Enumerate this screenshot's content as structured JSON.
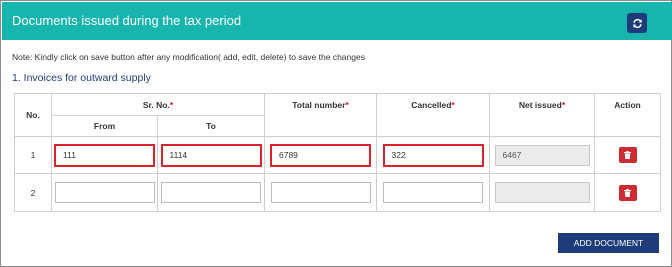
{
  "panel": {
    "title": "Documents issued during the tax period",
    "refresh_icon": "refresh-icon",
    "note": "Note: Kindly click on save button after any modification( add, edit, delete) to save the changes",
    "section_title": "1. Invoices for outward supply"
  },
  "table": {
    "headers": {
      "no": "No.",
      "sr_no": "Sr. No.",
      "from": "From",
      "to": "To",
      "total_number": "Total number",
      "cancelled": "Cancelled",
      "net_issued": "Net issued",
      "action": "Action"
    },
    "required_marker": "*",
    "rows": [
      {
        "no": "1",
        "from": "111",
        "to": "1114",
        "total_number": "6789",
        "cancelled": "322",
        "net_issued": "6467",
        "action_icon": "trash-icon"
      },
      {
        "no": "2",
        "from": "",
        "to": "",
        "total_number": "",
        "cancelled": "",
        "net_issued": "",
        "action_icon": "trash-icon"
      }
    ]
  },
  "add_document_label": "ADD DOCUMENT",
  "colors": {
    "header_bg": "#17b5ad",
    "navy": "#1f3c7a",
    "required": "#e0102a",
    "highlight_border": "#d9232e",
    "delete_bg": "#cf2b34"
  }
}
